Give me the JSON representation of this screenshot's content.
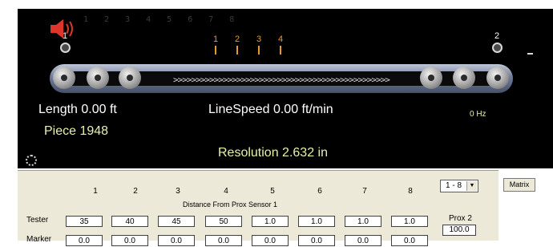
{
  "top_numbers": "1 2 3 4 5 6 7 8",
  "sensors": [
    "1",
    "2"
  ],
  "markers": [
    "1",
    "2",
    "3",
    "4"
  ],
  "conveyor": {
    "direction_glyphs": ">>>>>>>>>>>>>>>>>>>>>>>>>>>>>>>>>>>>>>>>>>>>>>>>"
  },
  "readouts": {
    "length": "Length 0.00 ft",
    "piece": "Piece  1948",
    "linespeed": "LineSpeed  0.00 ft/min",
    "frequency": "0 Hz",
    "resolution": "Resolution 2.632 in"
  },
  "grid": {
    "columns": [
      "1",
      "2",
      "3",
      "4",
      "5",
      "6",
      "7",
      "8"
    ],
    "caption": "Distance From Prox Sensor 1",
    "tester_label": "Tester",
    "tester_values": [
      "35",
      "40",
      "45",
      "50",
      "1.0",
      "1.0",
      "1.0",
      "1.0"
    ],
    "marker_label": "Marker",
    "marker_values": [
      "0.0",
      "0.0",
      "0.0",
      "0.0",
      "0.0",
      "0.0",
      "0.0",
      "0.0"
    ],
    "range_select": "1 - 8",
    "matrix_button": "Matrix",
    "prox2_label": "Prox 2",
    "prox2_value": "100.0"
  },
  "colors": {
    "panel_bg": "#000000",
    "marker": "#e79a2c",
    "readout_yellow": "#e8f2a6",
    "speaker": "#e0352b"
  }
}
